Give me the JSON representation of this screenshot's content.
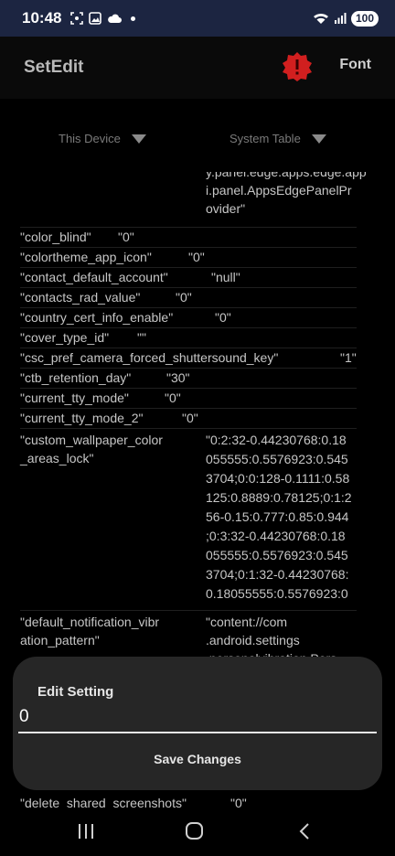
{
  "status_bar": {
    "time": "10:48",
    "battery": "100",
    "icons": [
      "screenshot-icon",
      "photo-icon",
      "cloud-icon",
      "dot-icon",
      "wifi-icon",
      "signal-icon",
      "battery-icon"
    ]
  },
  "app_bar": {
    "title": "SetEdit",
    "warning_icon": "warning-badge-icon",
    "font_label": "Font"
  },
  "dropdowns": {
    "device": "This Device",
    "table": "System Table"
  },
  "settings": {
    "partial_top": {
      "value_lines": [
        "y.panel.edge.apps.edge.app",
        "i.panel.AppsEdgePanelPr",
        "ovider\""
      ]
    },
    "rows": [
      {
        "key": "\"color_blind\"",
        "value": "\"0\""
      },
      {
        "key": "\"colortheme_app_icon\"",
        "value": "\"0\""
      },
      {
        "key": "\"contact_default_account\"",
        "value": "\"null\""
      },
      {
        "key": "\"contacts_rad_value\"",
        "value": "\"0\""
      },
      {
        "key": "\"country_cert_info_enable\"",
        "value": "\"0\""
      },
      {
        "key": "\"cover_type_id\"",
        "value": "\"\""
      },
      {
        "key": "\"csc_pref_camera_forced_shuttersound_key\"",
        "value": "\"1\""
      },
      {
        "key": "\"ctb_retention_day\"",
        "value": "\"30\""
      },
      {
        "key": "\"current_tty_mode\"",
        "value": "\"0\""
      },
      {
        "key": "\"current_tty_mode_2\"",
        "value": "\"0\""
      }
    ],
    "wallpaper": {
      "key_lines": [
        "\"custom_wallpaper_color",
        "_areas_lock\""
      ],
      "value_lines": [
        "\"0:2:32-0.44230768:0.18",
        "055555:0.5576923:0.545",
        "3704;0:0:128-0.1111:0.58",
        "125:0.8889:0.78125;0:1:2",
        "56-0.15:0.777:0.85:0.944",
        ";0:3:32-0.44230768:0.18",
        "055555:0.5576923:0.545",
        "3704;0:1:32-0.44230768:",
        "0.18055555:0.5576923:0"
      ]
    },
    "notification": {
      "key_lines": [
        "\"default_notification_vibr",
        "ation_pattern\""
      ],
      "value_lines": [
        "\"content://com",
        ".android.settings",
        ".personalvibration.Pers"
      ]
    },
    "partial_bottom": {
      "key": "\"delete_shared_screenshots\"",
      "value": "\"0\""
    }
  },
  "dialog": {
    "title": "Edit Setting",
    "value": "0",
    "save_label": "Save Changes"
  },
  "nav_bar": {
    "recents": "recents-icon",
    "home": "home-icon",
    "back": "back-icon"
  }
}
